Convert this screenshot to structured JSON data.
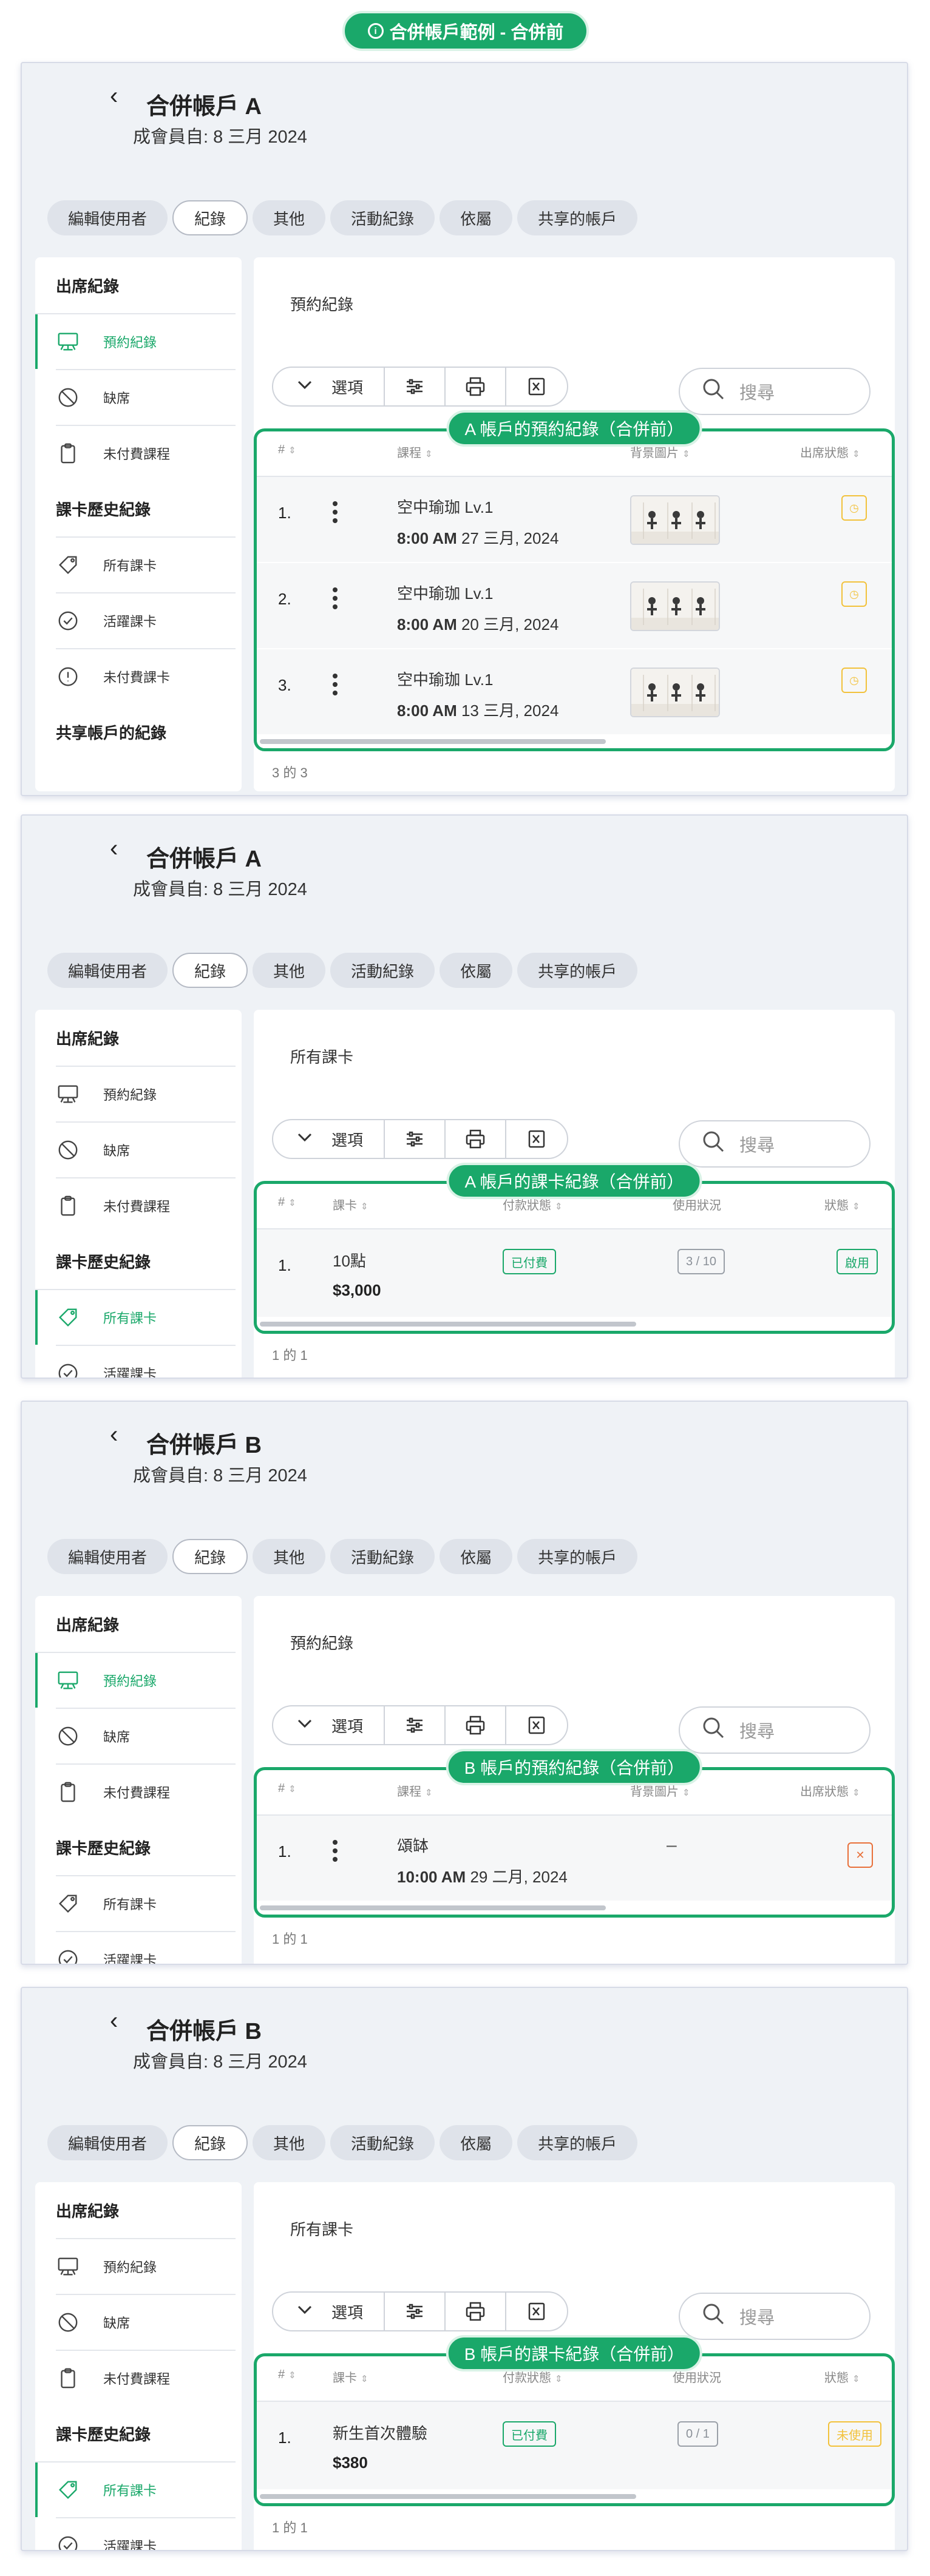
{
  "banner": {
    "icon": "info-circle-icon",
    "text": "合併帳戶範例 - 合併前"
  },
  "common": {
    "back_icon": "chevron-left-icon",
    "member_since": "成會員自: 8 三月 2024",
    "tabs": [
      "編輯使用者",
      "紀錄",
      "其他",
      "活動紀錄",
      "依屬",
      "共享的帳戶"
    ],
    "active_tab": "紀錄",
    "sidebar": {
      "attendance_heading": "出席紀錄",
      "attendance_items": [
        {
          "label": "預約紀錄",
          "icon": "presentation-board-icon"
        },
        {
          "label": "缺席",
          "icon": "ban-icon"
        },
        {
          "label": "未付費課程",
          "icon": "clipboard-icon"
        }
      ],
      "card_heading": "課卡歷史紀錄",
      "card_items": [
        {
          "label": "所有課卡",
          "icon": "tag-icon"
        },
        {
          "label": "活躍課卡",
          "icon": "check-circle-icon"
        },
        {
          "label": "未付費課卡",
          "icon": "alert-circle-icon"
        }
      ],
      "shared_heading": "共享帳戶的紀錄"
    },
    "toolbar": {
      "options_label": "選項",
      "icons": [
        "chevron-down-icon",
        "sliders-icon",
        "print-icon",
        "excel-icon"
      ]
    },
    "search_placeholder": "搜尋",
    "booking_headers": {
      "num": "#",
      "course": "課程",
      "image": "背景圖片",
      "status": "出席狀態"
    },
    "card_headers": {
      "num": "#",
      "card": "課卡",
      "payment": "付款狀態",
      "usage": "使用狀況",
      "status": "狀態"
    }
  },
  "sections": [
    {
      "account_title": "合併帳戶 A",
      "panel_title": "預約紀錄",
      "highlight_label": "A 帳戶的預約紀錄（合併前）",
      "rows": [
        {
          "num": "1.",
          "course": "空中瑜珈 Lv.1",
          "time": "8:00 AM",
          "date": "27 三月, 2024",
          "status_icon": "clock-icon"
        },
        {
          "num": "2.",
          "course": "空中瑜珈 Lv.1",
          "time": "8:00 AM",
          "date": "20 三月, 2024",
          "status_icon": "clock-icon"
        },
        {
          "num": "3.",
          "course": "空中瑜珈 Lv.1",
          "time": "8:00 AM",
          "date": "13 三月, 2024",
          "status_icon": "clock-icon"
        }
      ],
      "pager": "3 的 3"
    },
    {
      "account_title": "合併帳戶 A",
      "panel_title": "所有課卡",
      "highlight_label": "A 帳戶的課卡紀錄（合併前）",
      "rows": [
        {
          "num": "1.",
          "card": "10點",
          "price": "$3,000",
          "payment": "已付費",
          "usage": "3 / 10",
          "status": "啟用",
          "status_color": "green"
        }
      ],
      "pager": "1 的 1"
    },
    {
      "account_title": "合併帳戶 B",
      "panel_title": "預約紀錄",
      "highlight_label": "B 帳戶的預約紀錄（合併前）",
      "rows": [
        {
          "num": "1.",
          "course": "頌缽",
          "time": "10:00 AM",
          "date": "29 二月, 2024",
          "image": "–",
          "status_icon": "x-icon"
        }
      ],
      "pager": "1 的 1"
    },
    {
      "account_title": "合併帳戶 B",
      "panel_title": "所有課卡",
      "highlight_label": "B 帳戶的課卡紀錄（合併前）",
      "rows": [
        {
          "num": "1.",
          "card": "新生首次體驗",
          "price": "$380",
          "payment": "已付費",
          "usage": "0 / 1",
          "status": "未使用",
          "status_color": "yellow"
        }
      ],
      "pager": "1 的 1"
    }
  ]
}
